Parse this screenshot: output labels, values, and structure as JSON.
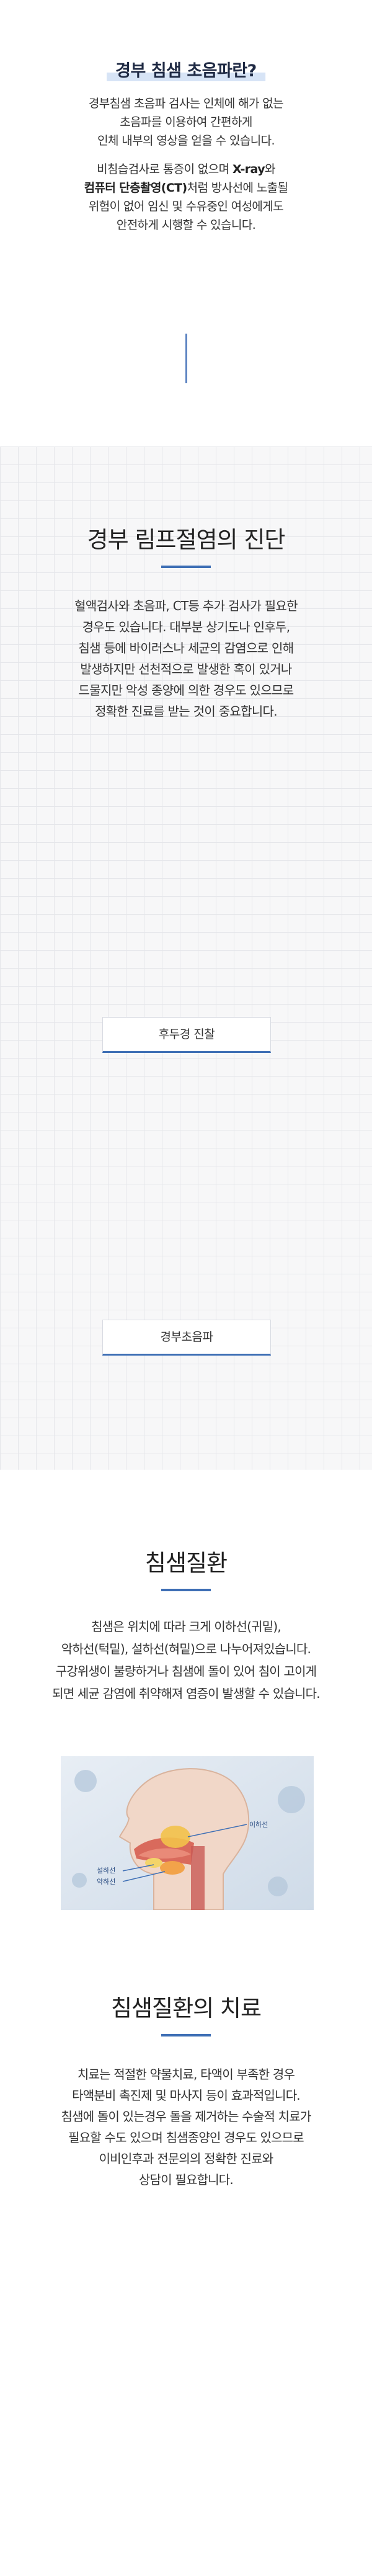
{
  "section1": {
    "title": "경부 침샘 초음파란?",
    "para1": [
      "경부침샘 초음파 검사는 인체에 해가 없는",
      "초음파를 이용하여 간편하게",
      "인체 내부의 영상을 얻을 수 있습니다."
    ],
    "para2_line1": "비침습검사로 통증이 없으며 ",
    "para2_line1_bold": "X-ray",
    "para2_line1_end": "와",
    "para2_line2_bold": "컴퓨터 단층촬영(CT)",
    "para2_line2_end": "처럼 방사선에 노출될",
    "para2_rest": [
      "위험이 없어 임신 및 수유중인 여성에게도",
      "안전하게 시행할 수 있습니다."
    ]
  },
  "section2": {
    "title": "경부 림프절염의 진단",
    "paragraph": [
      "혈액검사와 초음파, CT등 추가 검사가 필요한",
      "경우도 있습니다. 대부분 상기도나 인후두,",
      "침샘 등에 바이러스나 세균의 감염으로 인해",
      "발생하지만 선천적으로 발생한 혹이 있거나",
      "드물지만 악성 종양에 의한 경우도 있으므로",
      "정확한 진료를 받는 것이 중요합니다."
    ],
    "label1": "후두경 진찰",
    "label2": "경부초음파"
  },
  "section3": {
    "title": "침샘질환",
    "paragraph": [
      "침샘은 위치에 따라 크게 이하선(귀밑),",
      "악하선(턱밑), 설하선(혀밑)으로 나누어져있습니다.",
      "구강위생이 불량하거나 침샘에 돌이 있어 침이 고이게",
      "되면 세균 감염에 취약해져 염증이 발생할 수 있습니다."
    ],
    "diagram_labels": {
      "parotid": "이하선",
      "sublingual": "설하선",
      "submandibular": "악하선"
    }
  },
  "section4": {
    "title": "침샘질환의 치료",
    "paragraph": [
      "치료는 적절한 약물치료, 타액이 부족한 경우",
      "타액분비 촉진제 및 마사지 등이 효과적입니다.",
      "침샘에 돌이 있는경우 돌을 제거하는 수술적 치료가",
      "필요할 수도 있으며 침샘종양인 경우도 있으므로",
      "이비인후과 전문의의 정확한 진료와",
      "상담이 필요합니다."
    ]
  },
  "colors": {
    "accent": "#3e6fb5",
    "highlight": "#d7e4f6",
    "grid_bg": "#f7f7f8"
  }
}
